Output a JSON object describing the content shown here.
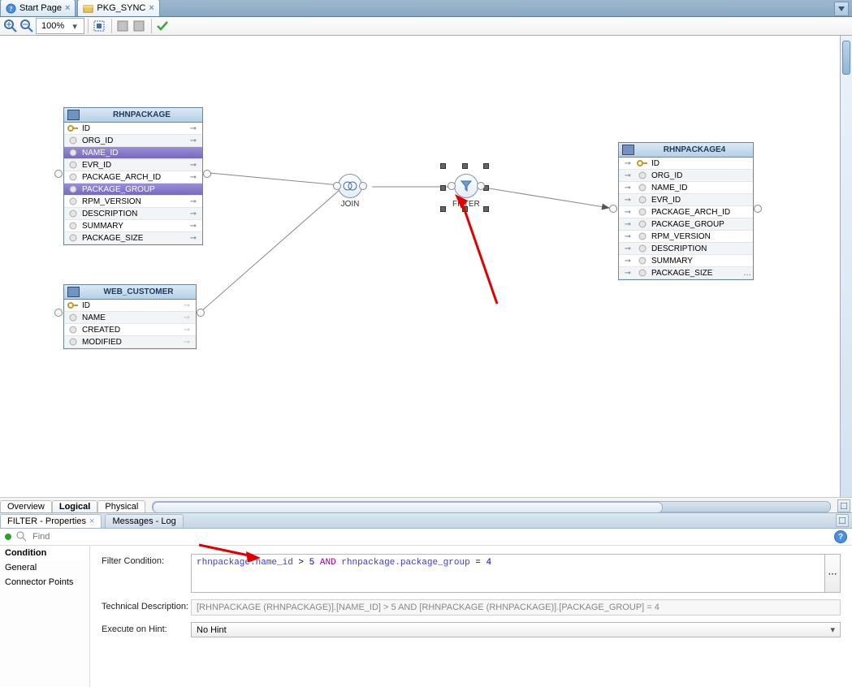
{
  "tabs": {
    "start": "Start Page",
    "pkg": "PKG_SYNC"
  },
  "toolbar": {
    "zoom": "100%"
  },
  "entities": {
    "rhnpackage": {
      "title": "RHNPACKAGE",
      "rows": [
        {
          "n": "ID",
          "k": true,
          "sel": false
        },
        {
          "n": "ORG_ID",
          "k": false,
          "sel": false
        },
        {
          "n": "NAME_ID",
          "k": false,
          "sel": true
        },
        {
          "n": "EVR_ID",
          "k": false,
          "sel": false
        },
        {
          "n": "PACKAGE_ARCH_ID",
          "k": false,
          "sel": false
        },
        {
          "n": "PACKAGE_GROUP",
          "k": false,
          "sel": true
        },
        {
          "n": "RPM_VERSION",
          "k": false,
          "sel": false
        },
        {
          "n": "DESCRIPTION",
          "k": false,
          "sel": false
        },
        {
          "n": "SUMMARY",
          "k": false,
          "sel": false
        },
        {
          "n": "PACKAGE_SIZE",
          "k": false,
          "sel": false
        }
      ]
    },
    "webcustomer": {
      "title": "WEB_CUSTOMER",
      "rows": [
        {
          "n": "ID",
          "k": true
        },
        {
          "n": "NAME",
          "k": false
        },
        {
          "n": "CREATED",
          "k": false
        },
        {
          "n": "MODIFIED",
          "k": false
        }
      ]
    },
    "rhnpackage4": {
      "title": "RHNPACKAGE4",
      "rows": [
        {
          "n": "ID",
          "k": true
        },
        {
          "n": "ORG_ID",
          "k": false
        },
        {
          "n": "NAME_ID",
          "k": false
        },
        {
          "n": "EVR_ID",
          "k": false
        },
        {
          "n": "PACKAGE_ARCH_ID",
          "k": false
        },
        {
          "n": "PACKAGE_GROUP",
          "k": false
        },
        {
          "n": "RPM_VERSION",
          "k": false
        },
        {
          "n": "DESCRIPTION",
          "k": false
        },
        {
          "n": "SUMMARY",
          "k": false
        },
        {
          "n": "PACKAGE_SIZE",
          "k": false
        }
      ],
      "more": "…"
    }
  },
  "nodes": {
    "join": "JOIN",
    "filter": "FILTER"
  },
  "viewtabs": {
    "overview": "Overview",
    "logical": "Logical",
    "physical": "Physical"
  },
  "proptabs": {
    "filter": "FILTER - Properties",
    "messages": "Messages - Log"
  },
  "findPlaceholder": "Find",
  "side": {
    "condition": "Condition",
    "general": "General",
    "connector": "Connector Points"
  },
  "form": {
    "filterCondLabel": "Filter Condition:",
    "filterCond": {
      "p1": "rhnpackage.name_id",
      "p2": " > ",
      "p3": "5",
      "p4": " AND ",
      "p5": "rhnpackage.package_group",
      "p6": " = ",
      "p7": "4"
    },
    "techDescLabel": "Technical Description:",
    "techDesc": "[RHNPACKAGE (RHNPACKAGE)].[NAME_ID] > 5 AND [RHNPACKAGE (RHNPACKAGE)].[PACKAGE_GROUP] = 4",
    "execHintLabel": "Execute on Hint:",
    "execHint": "No Hint"
  }
}
